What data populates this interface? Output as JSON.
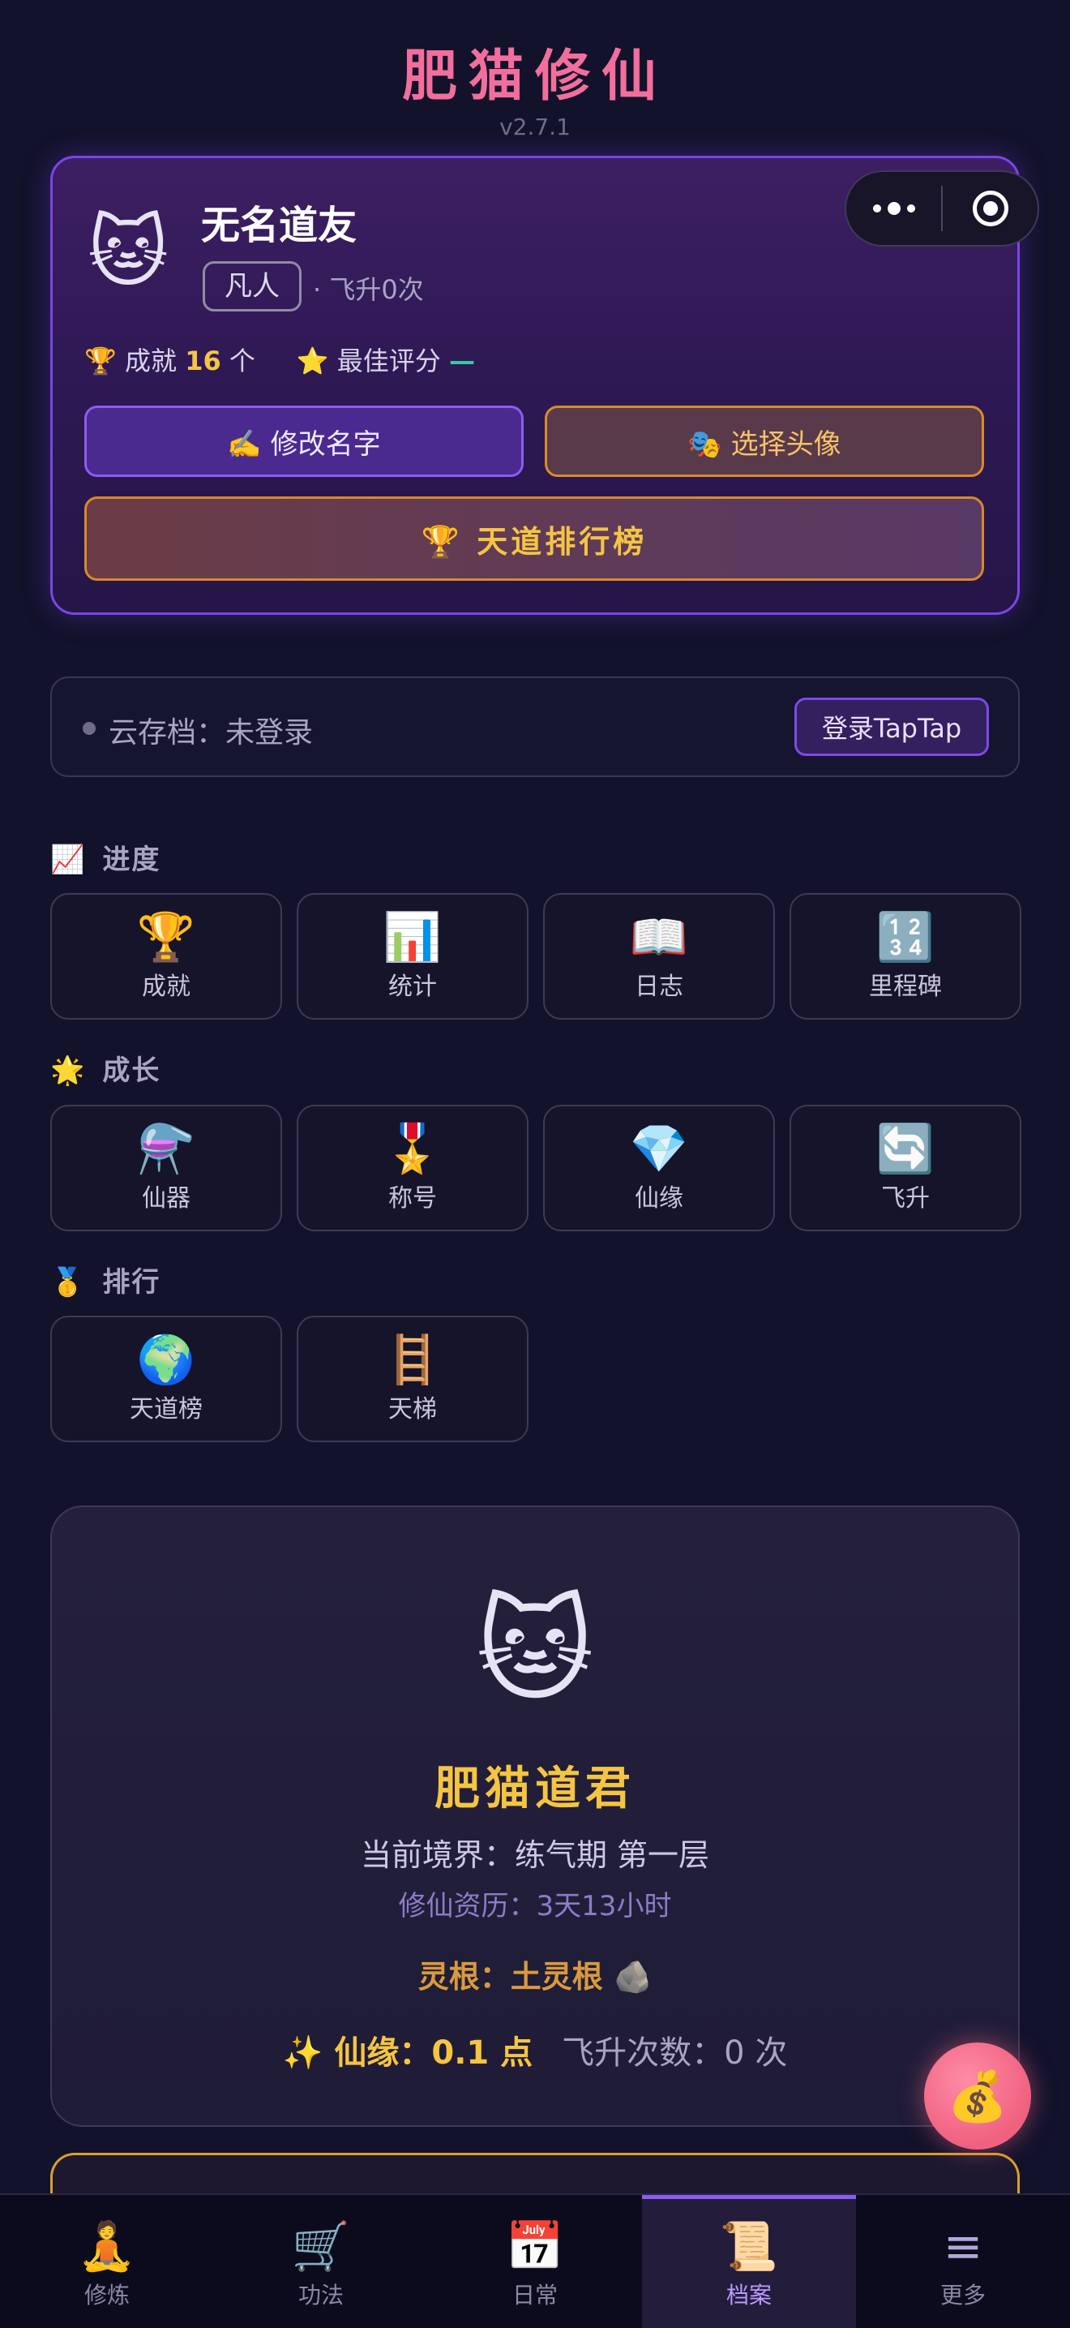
{
  "app": {
    "title": "肥猫修仙",
    "version": "v2.7.1"
  },
  "profile": {
    "avatar": "🐱",
    "name": "无名道友",
    "rank": "凡人",
    "ascend": "· 飞升0次",
    "achievements_label": "🏆 成就",
    "achievements_count": "16",
    "achievements_unit": "个",
    "best_score_label": "⭐ 最佳评分",
    "best_score_value": "—",
    "rename_label": "✍️ 修改名字",
    "choose_avatar_label": "🎭 选择头像",
    "leaderboard_label": "🏆 天道排行榜"
  },
  "capsule": {
    "more_icon": "more-dots-icon",
    "close_icon": "target-circle-icon"
  },
  "cloud": {
    "status": "云存档：未登录",
    "login_label": "登录TapTap"
  },
  "sections": [
    {
      "icon": "📈",
      "title": "进度",
      "items": [
        {
          "icon": "🏆",
          "label": "成就"
        },
        {
          "icon": "📊",
          "label": "统计"
        },
        {
          "icon": "📖",
          "label": "日志"
        },
        {
          "icon": "🔢",
          "label": "里程碑"
        }
      ]
    },
    {
      "icon": "🌟",
      "title": "成长",
      "items": [
        {
          "icon": "⚗️",
          "label": "仙器"
        },
        {
          "icon": "🎖️",
          "label": "称号"
        },
        {
          "icon": "💎",
          "label": "仙缘"
        },
        {
          "icon": "🔄",
          "label": "飞升"
        }
      ]
    },
    {
      "icon": "🥇",
      "title": "排行",
      "items": [
        {
          "icon": "🌍",
          "label": "天道榜"
        },
        {
          "icon": "🪜",
          "label": "天梯"
        }
      ]
    }
  ],
  "cat_card": {
    "avatar": "🐱",
    "title": "肥猫道君",
    "realm": "当前境界：练气期 第一层",
    "age": "修仙资历：3天13小时",
    "root": "灵根：土灵根 🪨",
    "fate": "✨ 仙缘：0.1 点",
    "ascend_count": "飞升次数：0 次"
  },
  "fab": {
    "icon": "💰"
  },
  "tabs": [
    {
      "icon": "🧘",
      "label": "修炼",
      "active": false
    },
    {
      "icon": "🛒",
      "label": "功法",
      "active": false
    },
    {
      "icon": "📅",
      "label": "日常",
      "active": false
    },
    {
      "icon": "📜",
      "label": "档案",
      "active": true
    },
    {
      "icon": "≡",
      "label": "更多",
      "active": false
    }
  ]
}
